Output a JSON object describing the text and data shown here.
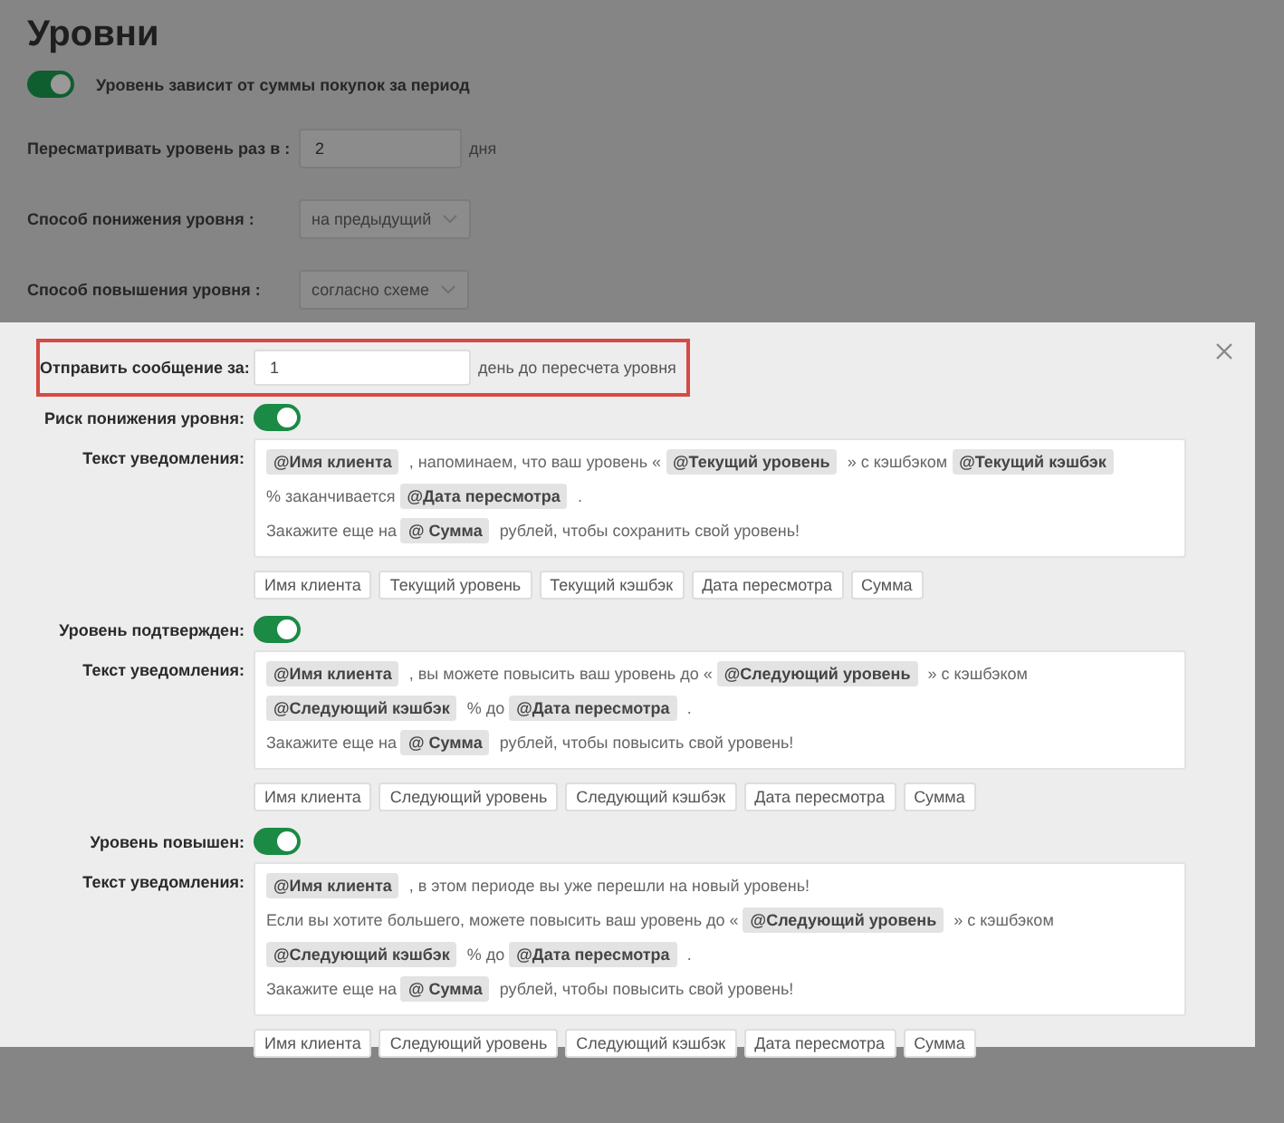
{
  "page": {
    "title": "Уровни",
    "depends_toggle": {
      "label": "Уровень зависит от суммы покупок за период",
      "on": true
    },
    "review_period": {
      "label": "Пересматривать уровень раз в :",
      "value": "2",
      "suffix": "дня"
    },
    "downgrade_method": {
      "label": "Способ понижения уровня :",
      "value": "на предыдущий"
    },
    "upgrade_method": {
      "label": "Способ повышения уровня :",
      "value": "согласно схеме"
    }
  },
  "dialog": {
    "send_before": {
      "label": "Отправить сообщение за:",
      "value": "1",
      "suffix": "день до пересчета уровня"
    },
    "sections": [
      {
        "label": "Риск понижения уровня:",
        "on": true,
        "text_label": "Текст уведомления:",
        "paragraphs": [
          [
            {
              "kind": "tag",
              "text": "@Имя клиента"
            },
            {
              "kind": "text",
              "text": ", напоминаем, что ваш уровень «"
            },
            {
              "kind": "tag",
              "text": "@Текущий уровень"
            },
            {
              "kind": "text",
              "text": "» с кэшбэком"
            },
            {
              "kind": "tag",
              "text": "@Текущий кэшбэк"
            },
            {
              "kind": "text",
              "text": "% заканчивается"
            },
            {
              "kind": "tag",
              "text": "@Дата пересмотра"
            },
            {
              "kind": "text",
              "text": "."
            }
          ],
          [
            {
              "kind": "text",
              "text": "Закажите еще на"
            },
            {
              "kind": "tag",
              "text": "@ Сумма"
            },
            {
              "kind": "text",
              "text": "рублей, чтобы сохранить свой уровень!"
            }
          ]
        ],
        "buttons": [
          "Имя клиента",
          "Текущий уровень",
          "Текущий кэшбэк",
          "Дата пересмотра",
          "Сумма"
        ]
      },
      {
        "label": "Уровень подтвержден:",
        "on": true,
        "text_label": "Текст уведомления:",
        "paragraphs": [
          [
            {
              "kind": "tag",
              "text": "@Имя клиента"
            },
            {
              "kind": "text",
              "text": ", вы можете повысить ваш уровень до «"
            },
            {
              "kind": "tag",
              "text": "@Следующий уровень"
            },
            {
              "kind": "text",
              "text": "» с кэшбэком"
            },
            {
              "kind": "tag",
              "text": "@Следующий кэшбэк"
            },
            {
              "kind": "text",
              "text": "% до"
            },
            {
              "kind": "tag",
              "text": "@Дата пересмотра"
            },
            {
              "kind": "text",
              "text": "."
            }
          ],
          [
            {
              "kind": "text",
              "text": "Закажите еще на"
            },
            {
              "kind": "tag",
              "text": "@ Сумма"
            },
            {
              "kind": "text",
              "text": "рублей, чтобы повысить свой уровень!"
            }
          ]
        ],
        "buttons": [
          "Имя клиента",
          "Следующий уровень",
          "Следующий кэшбэк",
          "Дата пересмотра",
          "Сумма"
        ]
      },
      {
        "label": "Уровень повышен:",
        "on": true,
        "text_label": "Текст уведомления:",
        "paragraphs": [
          [
            {
              "kind": "tag",
              "text": "@Имя клиента"
            },
            {
              "kind": "text",
              "text": ", в этом периоде вы уже перешли на новый уровень!"
            }
          ],
          [
            {
              "kind": "text",
              "text": "Если вы хотите большего, можете повысить ваш уровень до «"
            },
            {
              "kind": "tag",
              "text": "@Следующий уровень"
            },
            {
              "kind": "text",
              "text": "» с кэшбэком"
            },
            {
              "kind": "tag",
              "text": "@Следующий кэшбэк"
            },
            {
              "kind": "text",
              "text": "% до"
            },
            {
              "kind": "tag",
              "text": "@Дата пересмотра"
            },
            {
              "kind": "text",
              "text": "."
            }
          ],
          [
            {
              "kind": "text",
              "text": "Закажите еще на"
            },
            {
              "kind": "tag",
              "text": "@ Сумма"
            },
            {
              "kind": "text",
              "text": "рублей, чтобы повысить свой уровень!"
            }
          ]
        ],
        "buttons": [
          "Имя клиента",
          "Следующий уровень",
          "Следующий кэшбэк",
          "Дата пересмотра",
          "Сумма"
        ]
      }
    ]
  }
}
